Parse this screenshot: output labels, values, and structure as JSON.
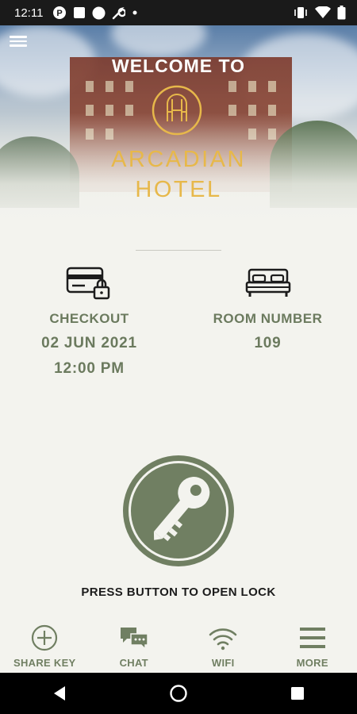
{
  "status_bar": {
    "time": "12:11",
    "left_icons": [
      "p-circle-icon",
      "square-icon",
      "circle-icon",
      "wrench-icon",
      "dot-icon"
    ],
    "right_icons": [
      "vibrate-icon",
      "wifi-icon",
      "battery-icon"
    ]
  },
  "header": {
    "welcome": "WELCOME TO",
    "hotel_name_line1": "ARCADIAN",
    "hotel_name_line2": "HOTEL",
    "brand_color": "#e7b84a"
  },
  "info": {
    "checkout_label": "CHECKOUT",
    "checkout_date": "02 JUN 2021",
    "checkout_time": "12:00 PM",
    "room_label": "ROOM NUMBER",
    "room_number": "109"
  },
  "lock": {
    "instruction": "PRESS BUTTON TO OPEN LOCK",
    "button_color": "#707f62"
  },
  "bottom_nav": [
    {
      "label": "SHARE KEY",
      "icon": "plus-circle-icon"
    },
    {
      "label": "CHAT",
      "icon": "chat-icon"
    },
    {
      "label": "WIFI",
      "icon": "wifi-icon"
    },
    {
      "label": "MORE",
      "icon": "menu-icon"
    }
  ],
  "system_nav": [
    "back-icon",
    "home-icon",
    "recents-icon"
  ],
  "colors": {
    "accent": "#707f62",
    "background": "#f3f3ee",
    "text_dark": "#1c1c1c"
  }
}
